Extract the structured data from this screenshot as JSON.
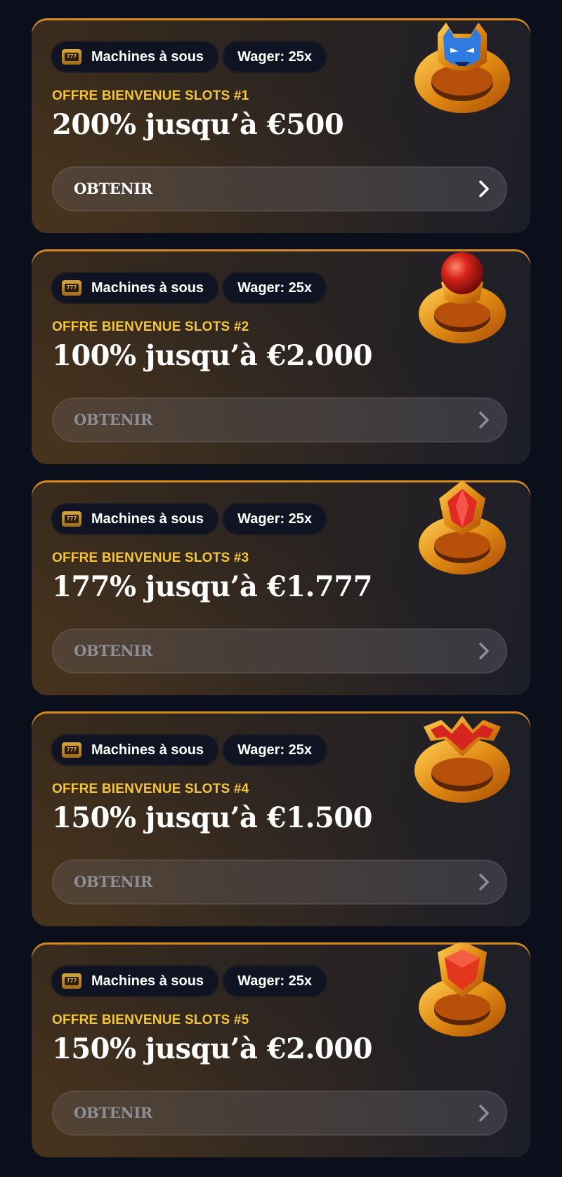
{
  "offers": [
    {
      "category": "Machines à sous",
      "wager": "Wager: 25x",
      "subtitle": "OFFRE BIENVENUE SLOTS #1",
      "title": "200% jusqu’à €500",
      "cta": "OBTENIR",
      "active": true,
      "gem_icon": "blue-demon-ring",
      "gem_color": "#2f7be0"
    },
    {
      "category": "Machines à sous",
      "wager": "Wager: 25x",
      "subtitle": "OFFRE BIENVENUE SLOTS #2",
      "title": "100% jusqu’à €2.000",
      "cta": "OBTENIR",
      "active": false,
      "gem_icon": "red-orb-ring",
      "gem_color": "#d8231c"
    },
    {
      "category": "Machines à sous",
      "wager": "Wager: 25x",
      "subtitle": "OFFRE BIENVENUE SLOTS #3",
      "title": "177% jusqu’à €1.777",
      "cta": "OBTENIR",
      "active": false,
      "gem_icon": "red-crystal-ring",
      "gem_color": "#e02a24"
    },
    {
      "category": "Machines à sous",
      "wager": "Wager: 25x",
      "subtitle": "OFFRE BIENVENUE SLOTS #4",
      "title": "150% jusqu’à €1.500",
      "cta": "OBTENIR",
      "active": false,
      "gem_icon": "red-bat-ring",
      "gem_color": "#d42520"
    },
    {
      "category": "Machines à sous",
      "wager": "Wager: 25x",
      "subtitle": "OFFRE BIENVENUE SLOTS #5",
      "title": "150% jusqu’à €2.000",
      "cta": "OBTENIR",
      "active": false,
      "gem_icon": "red-shield-gem-ring",
      "gem_color": "#e3361f"
    }
  ],
  "slot_icon_glyph": "777",
  "colors": {
    "accent": "#f4c53c",
    "border": "#d8891f",
    "background": "#0b0f1c"
  }
}
